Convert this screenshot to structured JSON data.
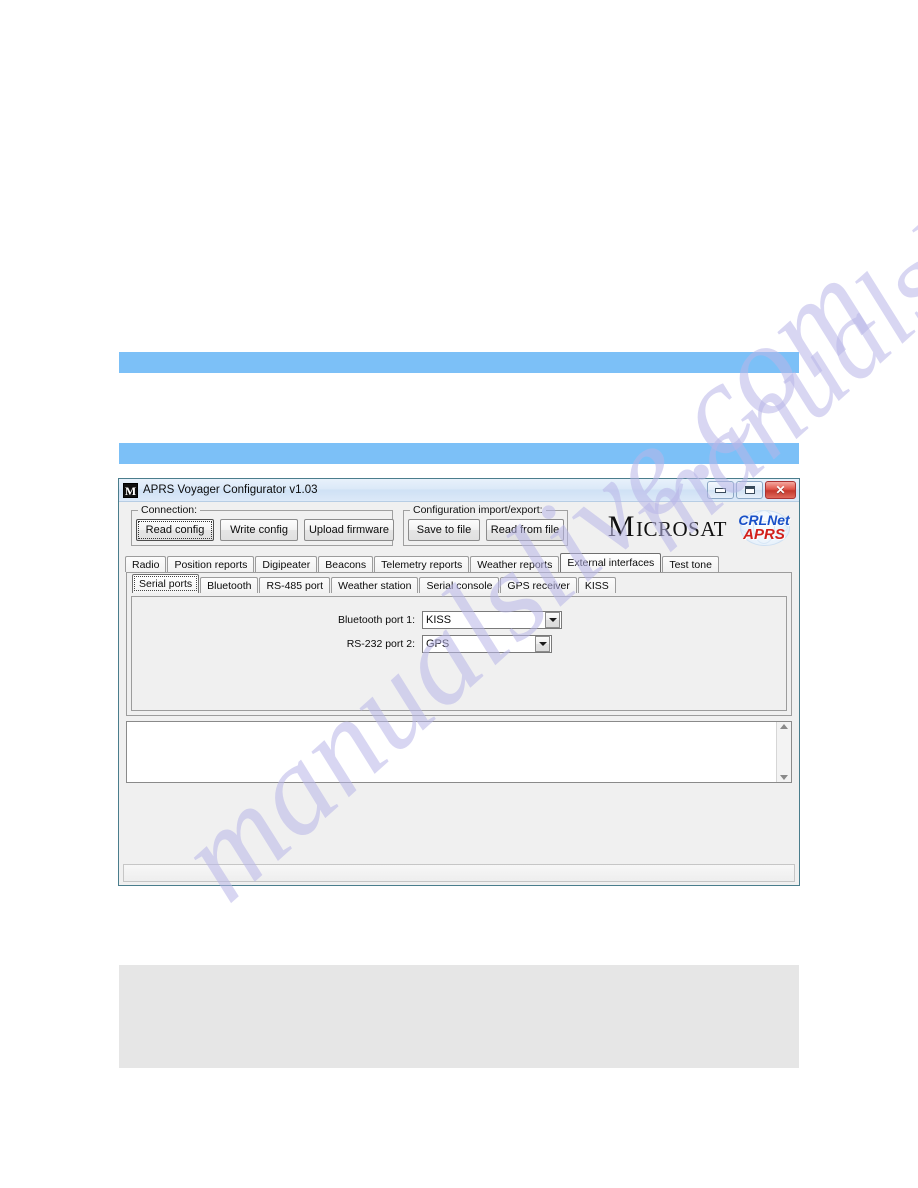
{
  "page": {
    "watermark_text_left": "manualslive.com",
    "watermark_text_right": "manualslive.com"
  },
  "window": {
    "title": "APRS Voyager Configurator v1.03",
    "icon_letter": "M",
    "caption": {
      "minimize_label": "–",
      "restore_label": "▭",
      "close_label": "✕"
    }
  },
  "toolbar": {
    "connection_group_title": "Connection:",
    "read_config_label": "Read config",
    "write_config_label": "Write config",
    "upload_firmware_label": "Upload firmware",
    "impexp_group_title": "Configuration import/export:",
    "save_to_file_label": "Save to file",
    "read_from_file_label": "Read from file"
  },
  "branding": {
    "microsat_first_letter": "M",
    "microsat_rest": "ICROSAT",
    "crlnet_line1": "CRLNet",
    "crlnet_line2": "APRS"
  },
  "tabs_main": [
    {
      "label": "Radio",
      "selected": false
    },
    {
      "label": "Position reports",
      "selected": false
    },
    {
      "label": "Digipeater",
      "selected": false
    },
    {
      "label": "Beacons",
      "selected": false
    },
    {
      "label": "Telemetry reports",
      "selected": false
    },
    {
      "label": "Weather reports",
      "selected": false
    },
    {
      "label": "External interfaces",
      "selected": true
    },
    {
      "label": "Test tone",
      "selected": false
    }
  ],
  "tabs_sub": [
    {
      "label": "Serial ports",
      "selected": true
    },
    {
      "label": "Bluetooth",
      "selected": false
    },
    {
      "label": "RS-485 port",
      "selected": false
    },
    {
      "label": "Weather station",
      "selected": false
    },
    {
      "label": "Serial console",
      "selected": false
    },
    {
      "label": "GPS receiver",
      "selected": false
    },
    {
      "label": "KISS",
      "selected": false
    }
  ],
  "form": {
    "rows": [
      {
        "label": "Bluetooth port 1:",
        "value": "KISS"
      },
      {
        "label": "RS-232 port 2:",
        "value": "GPS"
      }
    ]
  },
  "log": {
    "content": ""
  },
  "statusbar": {
    "text": ""
  },
  "colors": {
    "accent_bar": "#7cc0f7",
    "window_border": "#4a7d8c",
    "close_button": "#c4372c",
    "crlnet_blue": "#1850c8",
    "aprs_red": "#d2201c",
    "placeholder_block": "#e6e6e6"
  }
}
